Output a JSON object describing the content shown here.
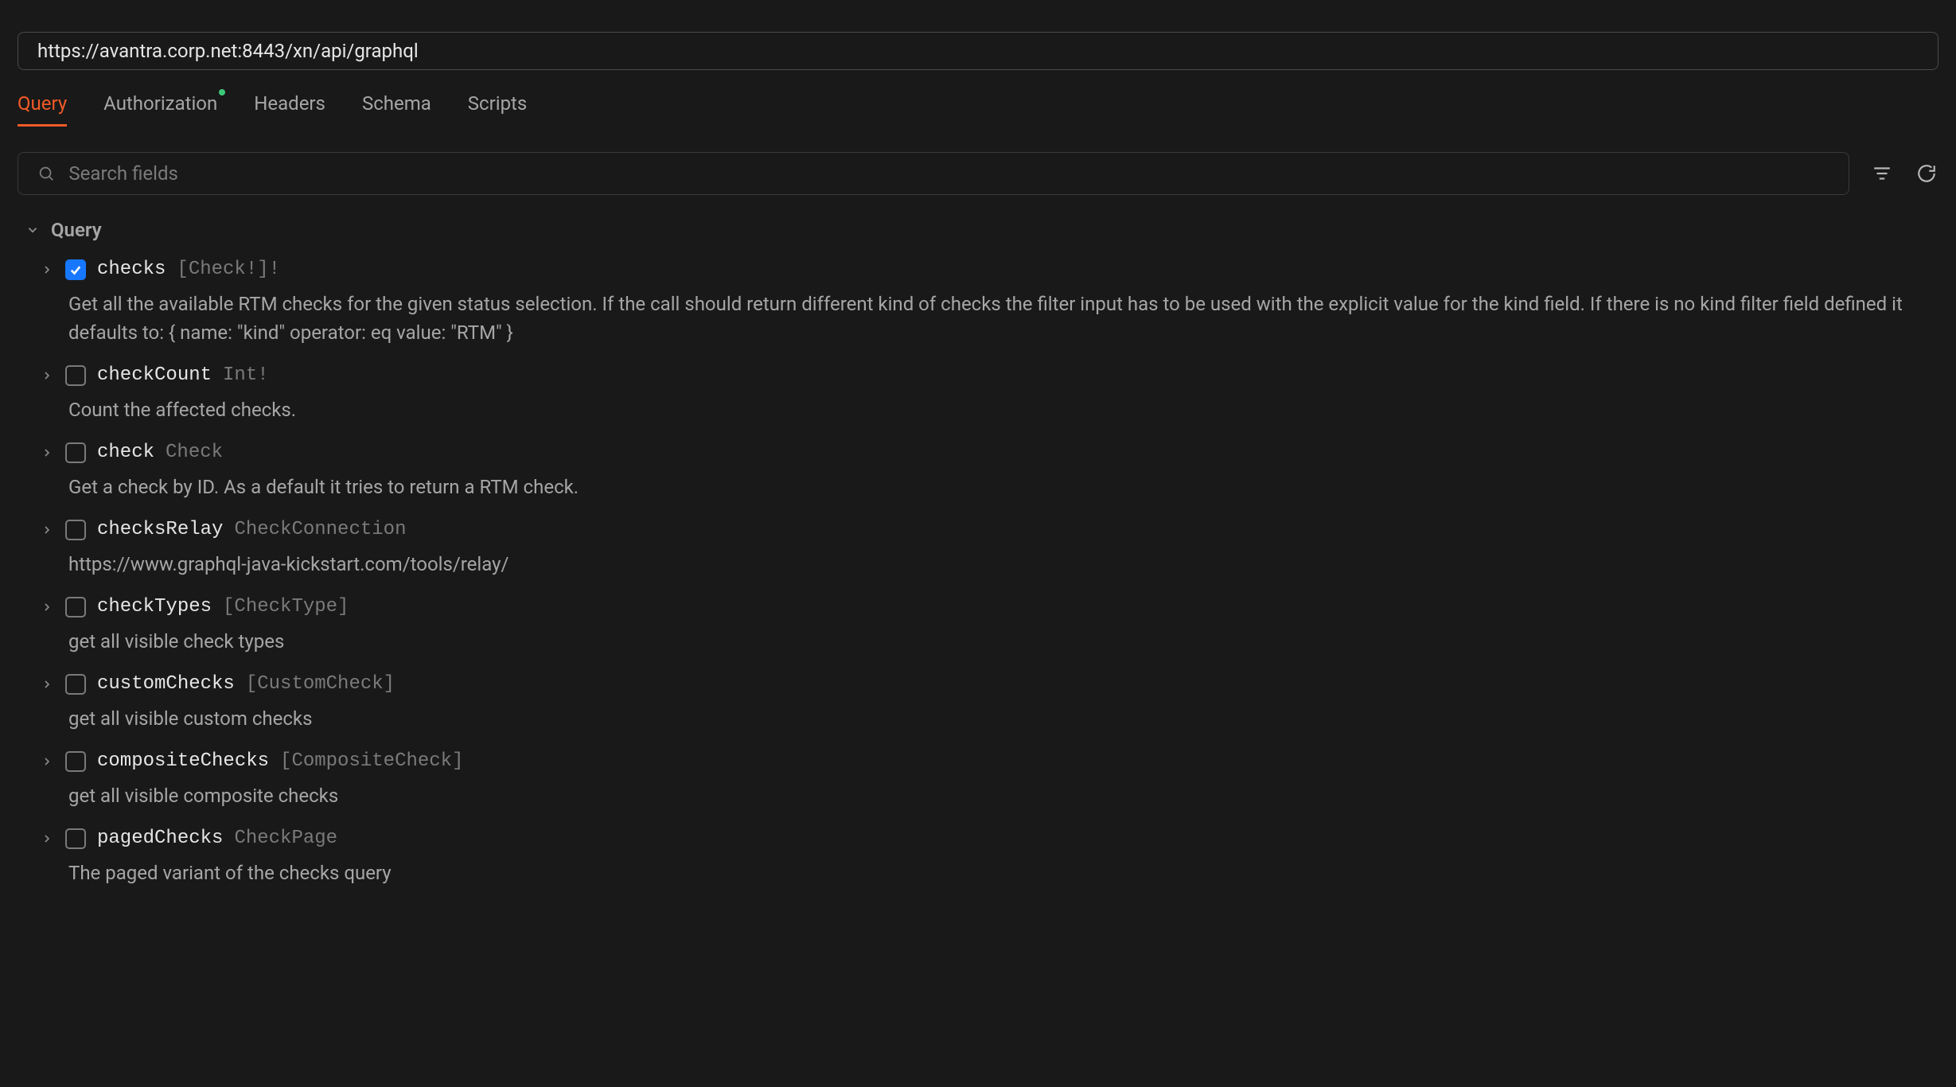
{
  "url": "https://avantra.corp.net:8443/xn/api/graphql",
  "tabs": [
    {
      "label": "Query",
      "active": true,
      "indicator": false
    },
    {
      "label": "Authorization",
      "active": false,
      "indicator": true
    },
    {
      "label": "Headers",
      "active": false,
      "indicator": false
    },
    {
      "label": "Schema",
      "active": false,
      "indicator": false
    },
    {
      "label": "Scripts",
      "active": false,
      "indicator": false
    }
  ],
  "search": {
    "placeholder": "Search fields"
  },
  "root": {
    "label": "Query"
  },
  "fields": [
    {
      "name": "checks",
      "type": "[Check!]!",
      "checked": true,
      "desc": "Get all the available RTM checks for the given status selection. If the call should return different kind of checks the filter input has to be used with the explicit value for the kind field. If there is no kind filter field defined it defaults to: { name: \"kind\" operator: eq value: \"RTM\" }"
    },
    {
      "name": "checkCount",
      "type": "Int!",
      "checked": false,
      "desc": "Count the affected checks."
    },
    {
      "name": "check",
      "type": "Check",
      "checked": false,
      "desc": "Get a check by ID. As a default it tries to return a RTM check."
    },
    {
      "name": "checksRelay",
      "type": "CheckConnection",
      "checked": false,
      "desc": "https://www.graphql-java-kickstart.com/tools/relay/"
    },
    {
      "name": "checkTypes",
      "type": "[CheckType]",
      "checked": false,
      "desc": "get all visible check types"
    },
    {
      "name": "customChecks",
      "type": "[CustomCheck]",
      "checked": false,
      "desc": "get all visible custom checks"
    },
    {
      "name": "compositeChecks",
      "type": "[CompositeCheck]",
      "checked": false,
      "desc": "get all visible composite checks"
    },
    {
      "name": "pagedChecks",
      "type": "CheckPage",
      "checked": false,
      "desc": "The paged variant of the checks query"
    }
  ]
}
